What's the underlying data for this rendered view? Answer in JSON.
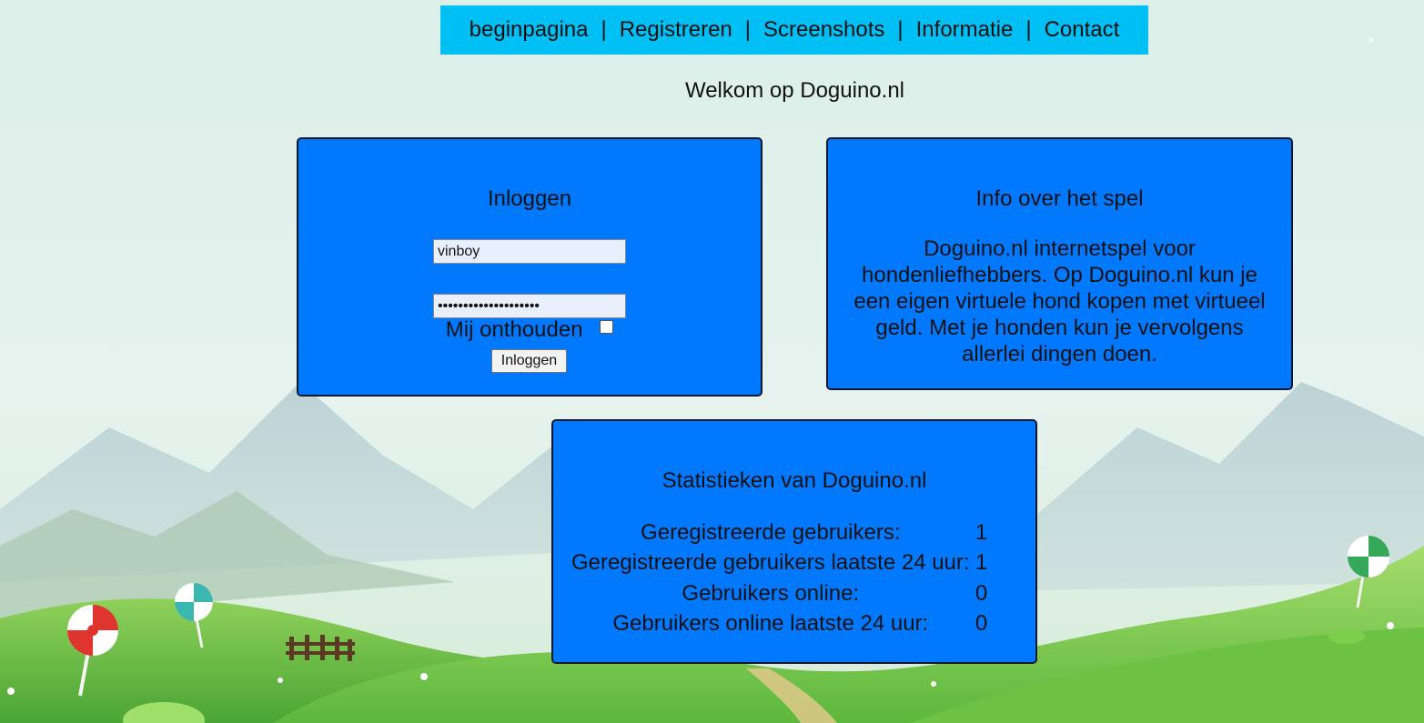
{
  "nav": {
    "items": [
      "beginpagina",
      "Registreren",
      "Screenshots",
      "Informatie",
      "Contact"
    ],
    "separator": "|"
  },
  "welcome": "Welkom op Doguino.nl",
  "login": {
    "title": "Inloggen",
    "username_value": "vinboy",
    "password_value": "••••••••••••••••••••",
    "remember_label": "Mij onthouden",
    "remember_checked": false,
    "button_label": "Inloggen"
  },
  "info": {
    "title": "Info over het spel",
    "text": "Doguino.nl internetspel voor hondenliefhebbers. Op Doguino.nl kun je een eigen virtuele hond kopen met virtueel geld. Met je honden kun je vervolgens allerlei dingen doen."
  },
  "stats": {
    "title": "Statistieken van Doguino.nl",
    "rows": [
      {
        "label": "Geregistreerde gebruikers:",
        "value": "1"
      },
      {
        "label": "Geregistreerde gebruikers laatste 24 uur:",
        "value": "1"
      },
      {
        "label": "Gebruikers online:",
        "value": "0"
      },
      {
        "label": "Gebruikers online laatste 24 uur:",
        "value": "0"
      }
    ]
  },
  "colors": {
    "nav_bg": "#00bff5",
    "panel_bg": "#0079ff",
    "panel_border": "#0b1630",
    "sky": "#d8eee6",
    "grass": "#5cb83c"
  }
}
